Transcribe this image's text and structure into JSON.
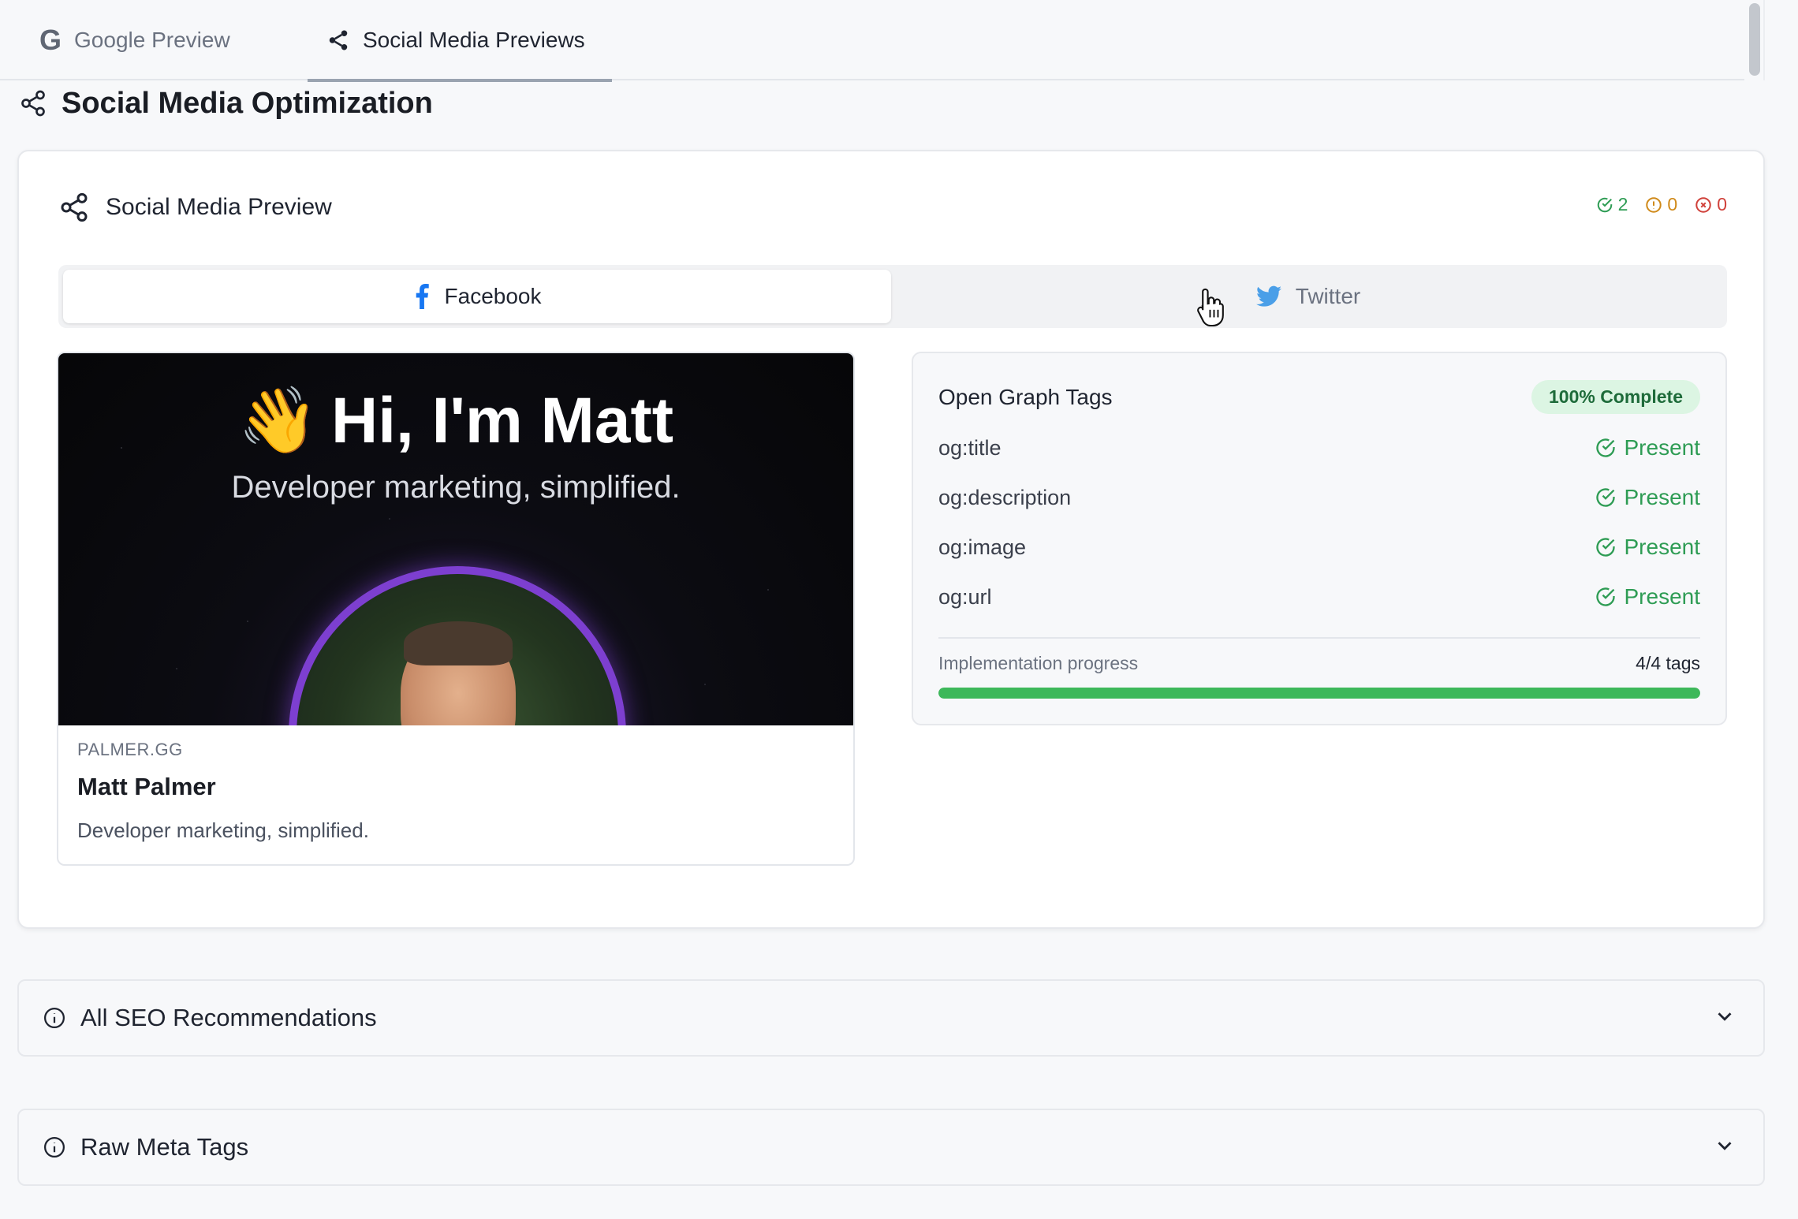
{
  "tabs": {
    "google_label": "Google Preview",
    "social_label": "Social Media Previews"
  },
  "section": {
    "title": "Social Media Optimization"
  },
  "card": {
    "title": "Social Media Preview",
    "counts": {
      "ok": "2",
      "warn": "0",
      "err": "0"
    },
    "platforms": {
      "facebook": "Facebook",
      "twitter": "Twitter"
    },
    "selected_platform": "Facebook"
  },
  "preview": {
    "hero_emoji": "👋",
    "hero_title": "Hi, I'm Matt",
    "hero_subtitle": "Developer marketing, simplified.",
    "domain": "PALMER.GG",
    "title": "Matt Palmer",
    "description": "Developer marketing, simplified."
  },
  "og": {
    "title": "Open Graph Tags",
    "badge": "100% Complete",
    "tags": [
      {
        "key": "og:title",
        "status": "Present"
      },
      {
        "key": "og:description",
        "status": "Present"
      },
      {
        "key": "og:image",
        "status": "Present"
      },
      {
        "key": "og:url",
        "status": "Present"
      }
    ],
    "progress_label": "Implementation progress",
    "progress_value": "4/4 tags",
    "progress_fraction": 1.0
  },
  "accordions": {
    "recommendations": "All SEO Recommendations",
    "raw_meta": "Raw Meta Tags"
  },
  "colors": {
    "success": "#2e9c54",
    "warning": "#d08a1a",
    "error": "#d0413a",
    "facebook": "#1877f2",
    "twitter": "#4a9fe8",
    "progress": "#3db85a"
  }
}
